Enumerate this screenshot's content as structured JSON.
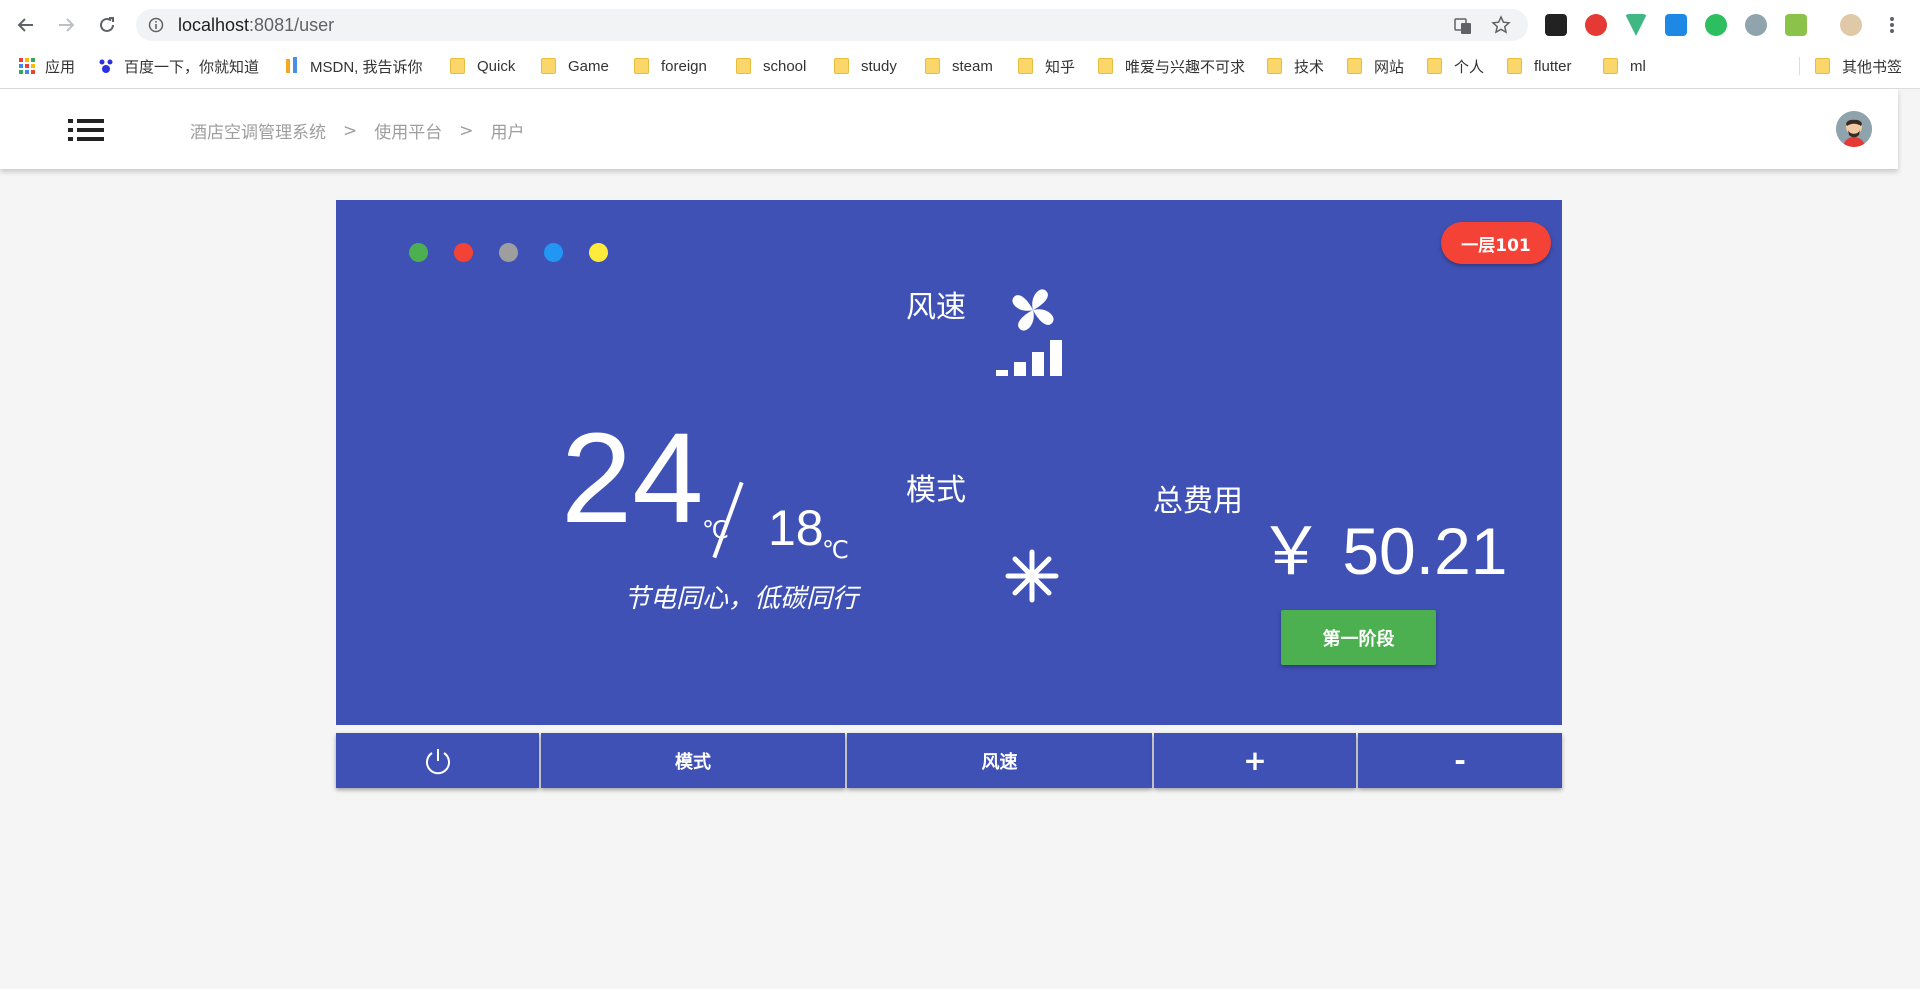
{
  "browser": {
    "url_host": "localhost",
    "url_path": ":8081/user",
    "bookmarks": [
      {
        "label": "应用",
        "icon": "apps-grid-icon"
      },
      {
        "label": "百度一下，你就知道",
        "icon": "baidu-icon"
      },
      {
        "label": "MSDN, 我告诉你",
        "icon": "msdn-icon"
      },
      {
        "label": "Quick",
        "icon": "folder-icon"
      },
      {
        "label": "Game",
        "icon": "folder-icon"
      },
      {
        "label": "foreign",
        "icon": "folder-icon"
      },
      {
        "label": "school",
        "icon": "folder-icon"
      },
      {
        "label": "study",
        "icon": "folder-icon"
      },
      {
        "label": "steam",
        "icon": "folder-icon"
      },
      {
        "label": "知乎",
        "icon": "folder-icon"
      },
      {
        "label": "唯爱与兴趣不可求",
        "icon": "folder-icon"
      },
      {
        "label": "技术",
        "icon": "folder-icon"
      },
      {
        "label": "网站",
        "icon": "folder-icon"
      },
      {
        "label": "个人",
        "icon": "folder-icon"
      },
      {
        "label": "flutter",
        "icon": "folder-icon"
      },
      {
        "label": "ml",
        "icon": "folder-icon"
      }
    ],
    "other_bookmarks": "其他书签"
  },
  "header": {
    "breadcrumb": [
      "酒店空调管理系统",
      "使用平台",
      "用户"
    ],
    "separator": ">"
  },
  "panel": {
    "status_dot_colors": [
      "#4caf50",
      "#f44336",
      "#9e9e9e",
      "#2196f3",
      "#ffeb3b"
    ],
    "room": "一层101",
    "wind_label": "风速",
    "wind_level_icon": "signal-bars-icon",
    "mode_label": "模式",
    "mode_icon": "snowflake-icon",
    "current_temp": "24",
    "current_unit": "℃",
    "target_temp": "18",
    "target_unit": "℃",
    "slogan": "节电同心，低碳同行",
    "fee_label": "总费用",
    "fee_value": "￥ 50.21",
    "stage_button": "第一阶段"
  },
  "controls": {
    "power_icon": "power-icon",
    "mode": "模式",
    "wind": "风速",
    "plus": "+",
    "minus": "-"
  }
}
